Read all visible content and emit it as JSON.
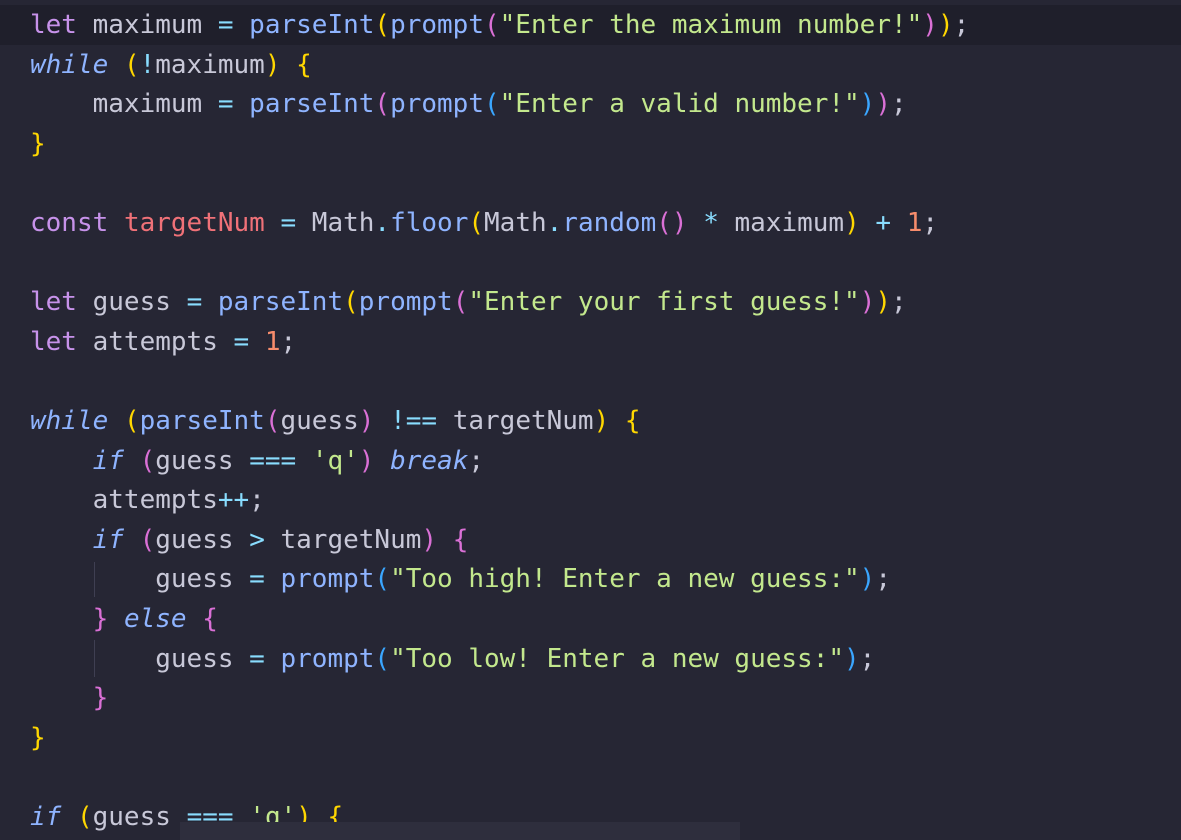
{
  "code": {
    "l1": {
      "let": "let",
      "var": "maximum",
      "eq": "=",
      "fn1": "parseInt",
      "p1": "(",
      "fn2": "prompt",
      "p2": "(",
      "str": "\"Enter the maximum number!\"",
      "p3": ")",
      "p4": ")",
      "semi": ";"
    },
    "l2": {
      "kw": "while",
      "p1": "(",
      "bang": "!",
      "var": "maximum",
      "p2": ")",
      "brace": "{"
    },
    "l3": {
      "var": "maximum",
      "eq": "=",
      "fn1": "parseInt",
      "p1": "(",
      "fn2": "prompt",
      "p2": "(",
      "str": "\"Enter a valid number!\"",
      "p3": ")",
      "p4": ")",
      "semi": ";"
    },
    "l4": {
      "brace": "}"
    },
    "l6": {
      "kw": "const",
      "var": "targetNum",
      "eq": "=",
      "obj1": "Math",
      "dot1": ".",
      "fn1": "floor",
      "p1": "(",
      "obj2": "Math",
      "dot2": ".",
      "fn2": "random",
      "p2": "()",
      "mul": "*",
      "var2": "maximum",
      "p3": ")",
      "plus": "+",
      "num": "1",
      "semi": ";"
    },
    "l8": {
      "let": "let",
      "var": "guess",
      "eq": "=",
      "fn1": "parseInt",
      "p1": "(",
      "fn2": "prompt",
      "p2": "(",
      "str": "\"Enter your first guess!\"",
      "p3": ")",
      "p4": ")",
      "semi": ";"
    },
    "l9": {
      "let": "let",
      "var": "attempts",
      "eq": "=",
      "num": "1",
      "semi": ";"
    },
    "l11": {
      "kw": "while",
      "p1": "(",
      "fn": "parseInt",
      "p2": "(",
      "var": "guess",
      "p3": ")",
      "op": "!==",
      "var2": "targetNum",
      "p4": ")",
      "brace": "{"
    },
    "l12": {
      "kw": "if",
      "p1": "(",
      "var": "guess",
      "op": "===",
      "str": "'q'",
      "p2": ")",
      "brk": "break",
      "semi": ";"
    },
    "l13": {
      "var": "attempts",
      "op": "++",
      "semi": ";"
    },
    "l14": {
      "kw": "if",
      "p1": "(",
      "var": "guess",
      "op": ">",
      "var2": "targetNum",
      "p2": ")",
      "brace": "{"
    },
    "l15": {
      "var": "guess",
      "eq": "=",
      "fn": "prompt",
      "p1": "(",
      "str": "\"Too high! Enter a new guess:\"",
      "p2": ")",
      "semi": ";"
    },
    "l16": {
      "brace1": "}",
      "kw": "else",
      "brace2": "{"
    },
    "l17": {
      "var": "guess",
      "eq": "=",
      "fn": "prompt",
      "p1": "(",
      "str": "\"Too low! Enter a new guess:\"",
      "p2": ")",
      "semi": ";"
    },
    "l18": {
      "brace": "}"
    },
    "l19": {
      "brace": "}"
    },
    "l21": {
      "kw": "if",
      "p1": "(",
      "var": "guess",
      "op": "===",
      "str": "'q'",
      "p2": ")",
      "brace": "{"
    }
  }
}
